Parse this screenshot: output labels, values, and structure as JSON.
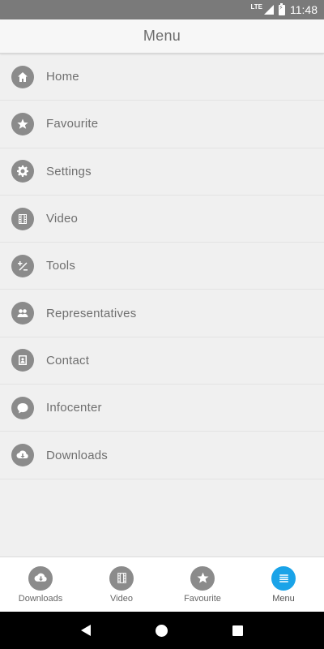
{
  "status_bar": {
    "network": "LTE",
    "time": "11:48"
  },
  "header": {
    "title": "Menu"
  },
  "menu": {
    "items": [
      {
        "label": "Home",
        "icon": "home-icon"
      },
      {
        "label": "Favourite",
        "icon": "star-icon"
      },
      {
        "label": "Settings",
        "icon": "gear-icon"
      },
      {
        "label": "Video",
        "icon": "film-icon"
      },
      {
        "label": "Tools",
        "icon": "calculator-icon"
      },
      {
        "label": "Representatives",
        "icon": "people-icon"
      },
      {
        "label": "Contact",
        "icon": "contact-card-icon"
      },
      {
        "label": "Infocenter",
        "icon": "speech-bubble-icon"
      },
      {
        "label": "Downloads",
        "icon": "cloud-download-icon"
      }
    ]
  },
  "tabbar": {
    "tabs": [
      {
        "label": "Downloads",
        "icon": "cloud-download-icon",
        "active": false
      },
      {
        "label": "Video",
        "icon": "film-icon",
        "active": false
      },
      {
        "label": "Favourite",
        "icon": "star-icon",
        "active": false
      },
      {
        "label": "Menu",
        "icon": "menu-lines-icon",
        "active": true
      }
    ]
  },
  "colors": {
    "status_bar": "#7a7a7a",
    "icon_gray": "#8b8b8b",
    "active_tab": "#1aa3e8",
    "background": "#f0f0f0"
  }
}
